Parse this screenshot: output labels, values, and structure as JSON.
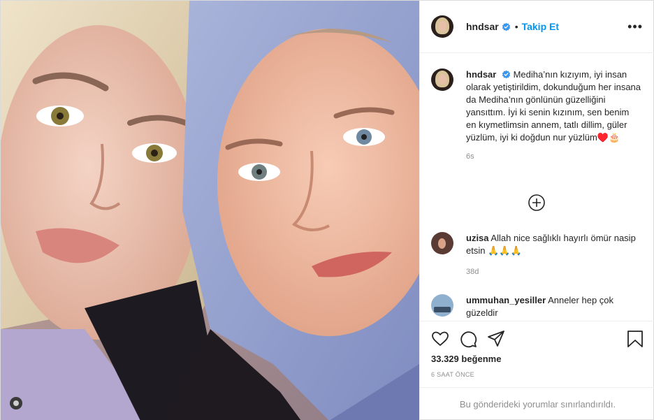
{
  "post": {
    "image_alt": "Two women selfie",
    "author": {
      "username": "hndsar",
      "verified": true,
      "follow_label": "Takip Et",
      "more_icon": "more-horizontal-icon"
    },
    "caption": {
      "username": "hndsar",
      "text": "Mediha’nın kızıyım, iyi insan olarak yetiştirildim, dokunduğum her insana da Mediha’nın gönlünün güzelliğini yansıttım. İyi ki senin kızınım, sen benim en kıymetlimsin annem, tatlı dillim, güler yüzlüm, iyi ki doğdun nur yüzlüm♥️🎂",
      "time": "6s"
    },
    "load_more_icon": "plus-circle-icon",
    "comments": [
      {
        "username": "uzisa",
        "text": "Allah nice sağlıklı hayırlı ömür nasip etsin 🙏🙏🙏",
        "time": "38d"
      },
      {
        "username": "ummuhan_yesiller",
        "text": "Anneler hep çok güzeldir",
        "time": ""
      }
    ],
    "actions": {
      "like_icon": "heart-icon",
      "comment_icon": "comment-icon",
      "share_icon": "send-icon",
      "save_icon": "bookmark-icon"
    },
    "likes": "33.329 beğenme",
    "posted_time": "6 SAAT ÖNCE",
    "comments_limited": "Bu gönderideki yorumlar sınırlandırıldı."
  },
  "colors": {
    "accent": "#0095f6",
    "text": "#262626",
    "muted": "#8e8e8e",
    "border": "#efefef"
  }
}
